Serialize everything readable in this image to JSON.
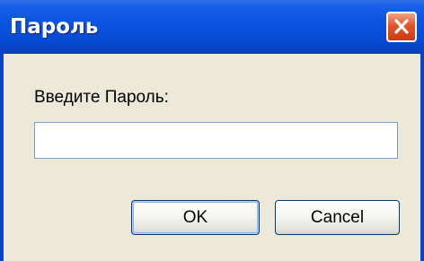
{
  "dialog": {
    "title": "Пароль",
    "prompt_label": "Введите Пароль:",
    "password_value": "",
    "ok_label": "OK",
    "cancel_label": "Cancel"
  },
  "icons": {
    "close": "close-icon"
  },
  "colors": {
    "titlebar": "#0a53e0",
    "close_button": "#e2542c",
    "window_background": "#ece9d8",
    "input_border": "#7f9db9",
    "button_border": "#003c74"
  }
}
